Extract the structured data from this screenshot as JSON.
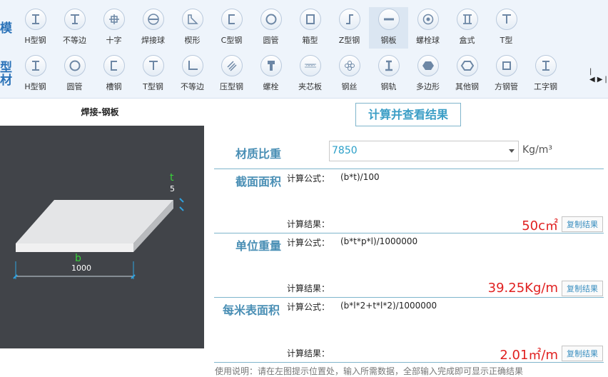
{
  "toolbar": {
    "side_label_top": "模",
    "side_label_bottom": [
      "型",
      "材"
    ],
    "row1": [
      {
        "label": "H型钢",
        "icon": "i-beam-icon"
      },
      {
        "label": "不等边",
        "icon": "t-beam-icon"
      },
      {
        "label": "十字",
        "icon": "cross-icon"
      },
      {
        "label": "焊接球",
        "icon": "welded-ball-icon"
      },
      {
        "label": "楔形",
        "icon": "wedge-icon"
      },
      {
        "label": "C型钢",
        "icon": "c-channel-icon"
      },
      {
        "label": "圆管",
        "icon": "round-tube-icon"
      },
      {
        "label": "箱型",
        "icon": "box-section-icon"
      },
      {
        "label": "Z型钢",
        "icon": "z-section-icon"
      },
      {
        "label": "钢板",
        "icon": "plate-icon",
        "active": true
      },
      {
        "label": "螺栓球",
        "icon": "bolt-ball-icon"
      },
      {
        "label": "盒式",
        "icon": "box-type-icon"
      },
      {
        "label": "T型",
        "icon": "t-section-icon"
      }
    ],
    "row2": [
      {
        "label": "H型钢",
        "icon": "i-beam-icon"
      },
      {
        "label": "圆管",
        "icon": "round-tube-icon"
      },
      {
        "label": "槽钢",
        "icon": "channel-icon"
      },
      {
        "label": "T型钢",
        "icon": "t-section-icon"
      },
      {
        "label": "不等边",
        "icon": "angle-icon"
      },
      {
        "label": "压型钢",
        "icon": "profiled-steel-icon"
      },
      {
        "label": "螺栓",
        "icon": "bolt-icon"
      },
      {
        "label": "夹芯板",
        "icon": "sandwich-panel-icon"
      },
      {
        "label": "钢丝",
        "icon": "steel-wire-icon"
      },
      {
        "label": "钢轨",
        "icon": "rail-icon"
      },
      {
        "label": "多边形",
        "icon": "polygon-icon"
      },
      {
        "label": "其他钢",
        "icon": "other-steel-icon"
      },
      {
        "label": "方钢管",
        "icon": "square-tube-icon"
      },
      {
        "label": "工字钢",
        "icon": "i-steel-icon"
      }
    ]
  },
  "panel": {
    "title": "焊接-钢板",
    "dims": {
      "t_label": "t",
      "t_value": "5",
      "b_label": "b",
      "b_value": "1000"
    }
  },
  "main": {
    "calc_button": "计算并查看结果",
    "density_label": "材质比重",
    "density_value": "7850",
    "density_unit": "Kg/m³",
    "formula_key": "计算公式：",
    "result_key": "计算结果：",
    "copy_label": "复制结果",
    "sections": [
      {
        "label": "截面面积",
        "formula": "(b*t)/100",
        "result": "50c㎡"
      },
      {
        "label": "单位重量",
        "formula": "(b*t*p*l)/1000000",
        "result": "39.25Kg/m"
      },
      {
        "label": "每米表面积",
        "formula": "(b*l*2+t*l*2)/1000000",
        "result": "2.01㎡/m"
      }
    ],
    "footer_note": "使用说明：请在左图提示位置处，输入所需数据，全部输入完成即可显示正确结果"
  },
  "colors": {
    "accent": "#4a8fb5",
    "result": "#e02020",
    "preview_bg": "#414449"
  }
}
